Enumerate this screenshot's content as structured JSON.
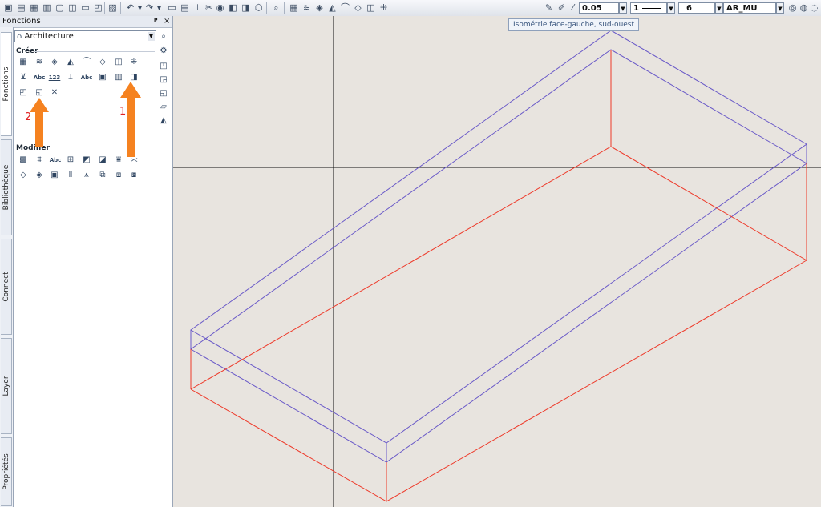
{
  "toolbar": {
    "pen_thickness": "0.05",
    "line_type": "1",
    "color_number": "6",
    "color_swatch": "#e8222a",
    "layer_name": "AR_MU"
  },
  "tooltip": "Isométrie face-gauche, sud-ouest",
  "panel": {
    "title": "Fonctions",
    "pin": "ᵖ",
    "close": "×",
    "category": "Architecture",
    "section_create": "Créer",
    "section_modify": "Modifier",
    "tabs": [
      "Fonctions",
      "Bibliothèque",
      "Connect",
      "Layer",
      "Propriétés"
    ]
  },
  "create_icon_labels": {
    "abc": "Abc",
    "num": "123",
    "abc2": "Abc"
  },
  "modify_icon_labels": {
    "abc": "Abc"
  },
  "annotations": {
    "arrow1_label": "1",
    "arrow2_label": "2",
    "arrow_color": "#f58220",
    "label_color": "#e02020"
  },
  "drawing_colors": {
    "outline_blue": "#6a5ac8",
    "outline_red": "#ee3a2a",
    "crosshair": "#111111"
  }
}
